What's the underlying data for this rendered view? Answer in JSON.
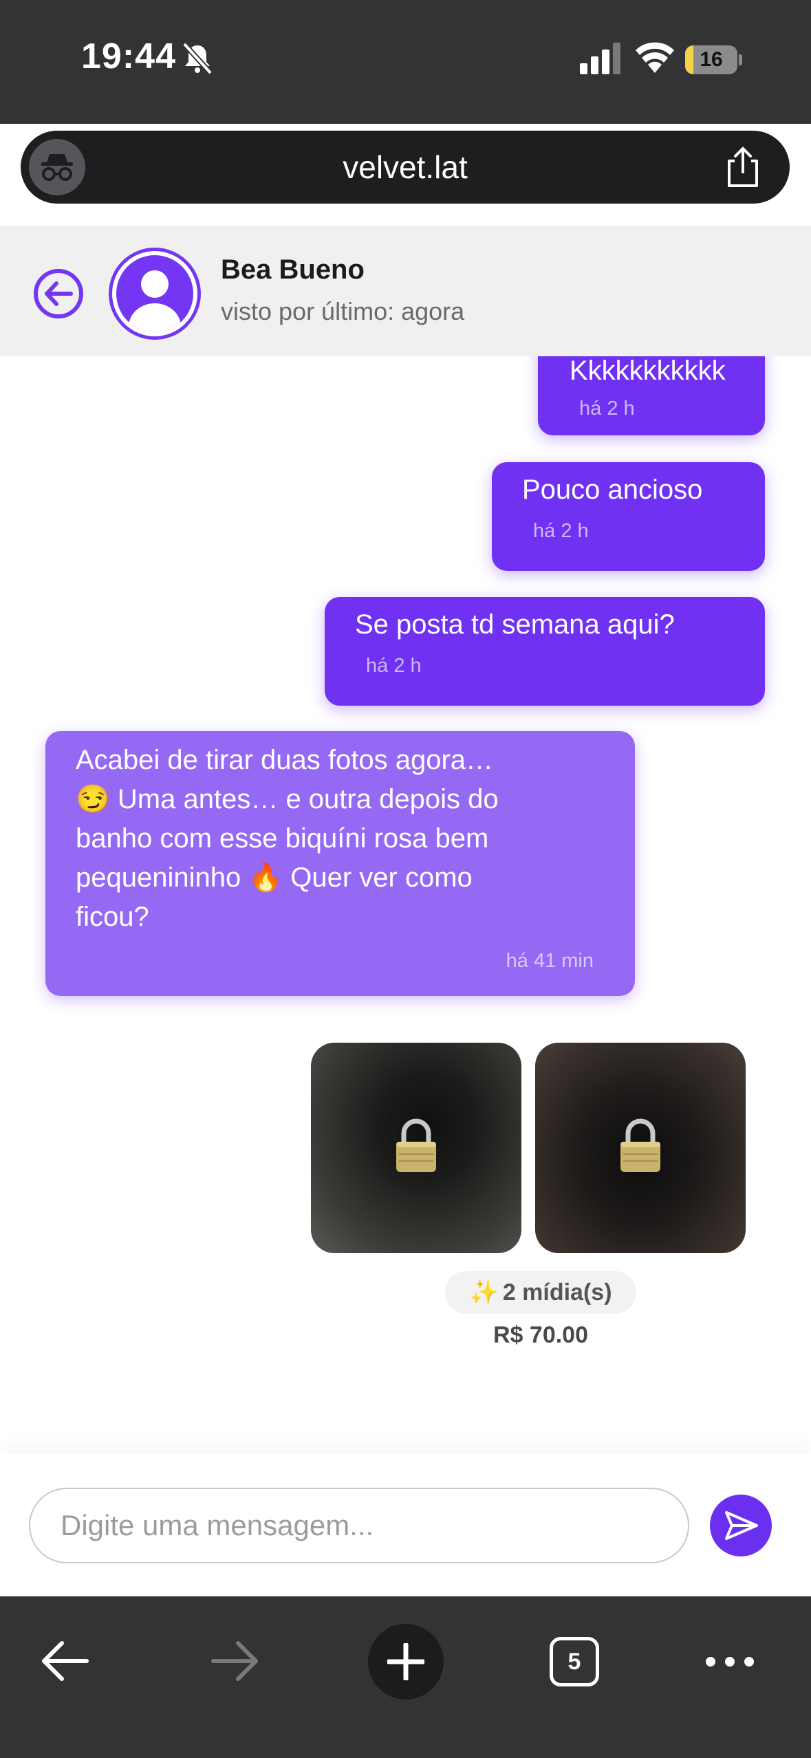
{
  "status_bar": {
    "time": "19:44",
    "battery": "16",
    "battery_level": 0.16
  },
  "browser": {
    "url": "velvet.lat",
    "tab_count": "5"
  },
  "chat": {
    "contact_name": "Bea Bueno",
    "contact_status": "visto por último: agora",
    "accent_color": "#7031f2",
    "incoming_color": "#9569f4"
  },
  "messages": [
    {
      "direction": "out",
      "text": "Kkkkkkkkkkk",
      "time": "há 2 h"
    },
    {
      "direction": "out",
      "text": "Pouco ancioso",
      "time": "há 2 h"
    },
    {
      "direction": "out",
      "text": "Se posta td semana aqui?",
      "time": "há 2 h"
    },
    {
      "direction": "in",
      "lines": [
        "Acabei de tirar duas fotos agora…",
        "😏 Uma antes… e outra depois do",
        "banho com esse biquíni rosa bem",
        "pequenininho 🔥 Quer ver como",
        "ficou?"
      ],
      "time": "há 41 min"
    }
  ],
  "media": {
    "badge": "2 mídia(s)",
    "price": "R$ 70.00",
    "thumbnails": [
      "locked",
      "locked"
    ]
  },
  "composer": {
    "placeholder": "Digite uma mensagem..."
  }
}
